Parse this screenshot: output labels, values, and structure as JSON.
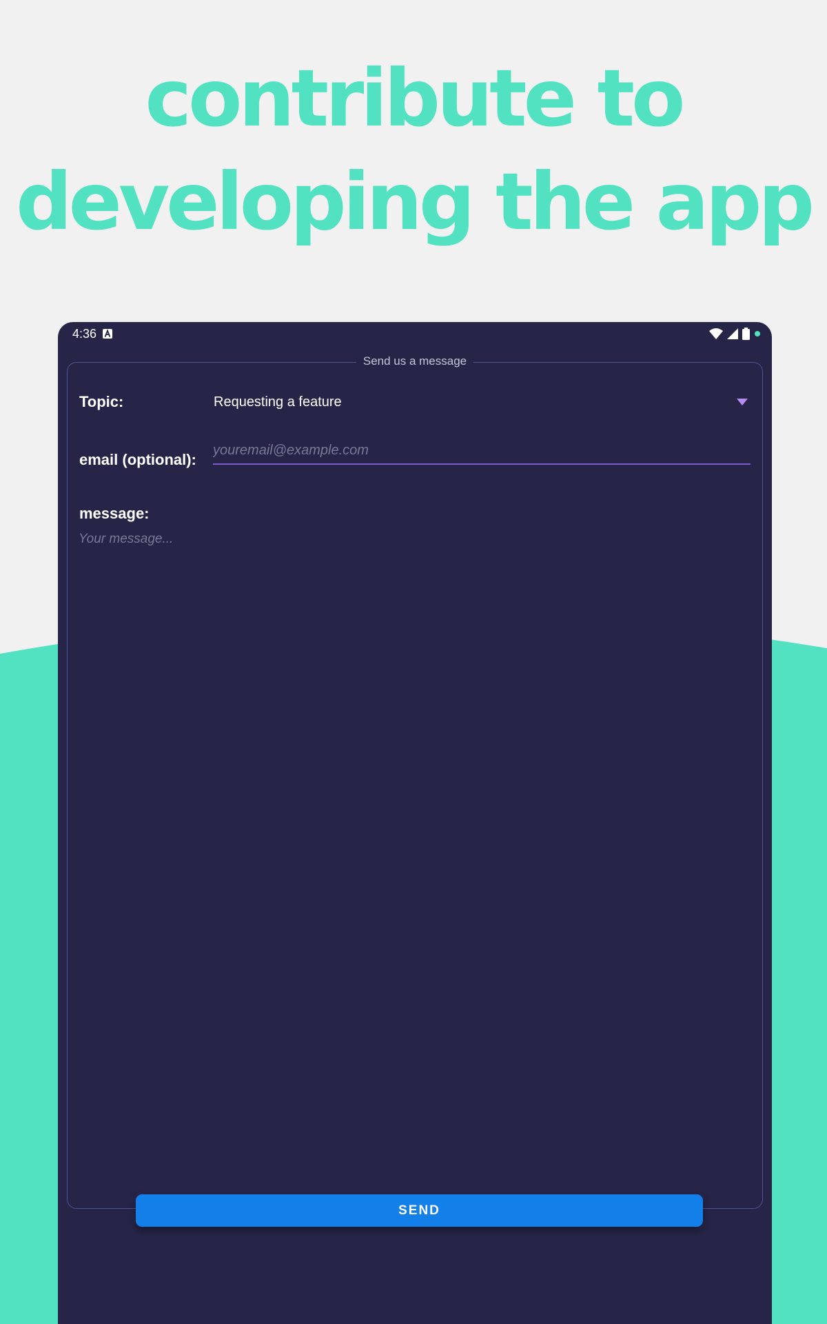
{
  "headline": {
    "line1": "contribute to",
    "line2": "developing the app"
  },
  "status_bar": {
    "time": "4:36",
    "icons": [
      "app-a-icon",
      "wifi-icon",
      "signal-icon",
      "battery-icon",
      "dot-indicator-icon"
    ]
  },
  "form": {
    "legend": "Send us a message",
    "topic": {
      "label": "Topic:",
      "selected": "Requesting a feature"
    },
    "email": {
      "label": "email (optional):",
      "placeholder": "youremail@example.com",
      "value": ""
    },
    "message": {
      "label": "message:",
      "placeholder": "Your message...",
      "value": ""
    },
    "send_label": "SEND"
  },
  "colors": {
    "accent_green": "#52e2c1",
    "device_bg": "#262548",
    "send_button": "#137fe9",
    "underline": "#7e5cd0",
    "dropdown_arrow": "#b48cf0"
  }
}
